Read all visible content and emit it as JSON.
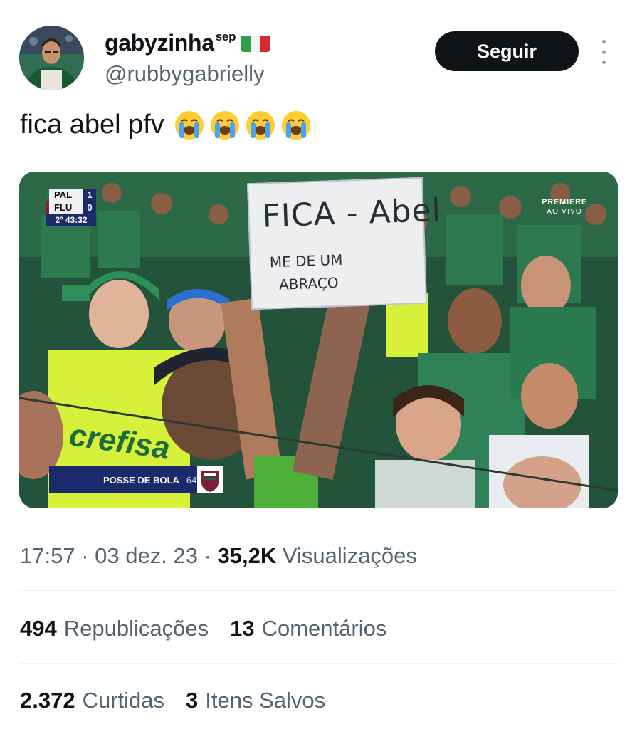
{
  "user": {
    "display_name": "gabyzinha",
    "name_suffix": "sep",
    "handle": "@rubbygabrielly"
  },
  "follow_label": "Seguir",
  "tweet": {
    "text": "fica abel pfv",
    "emoji_name": "loudly-crying-face",
    "emoji_count": 4
  },
  "media": {
    "scoreboard": {
      "home": "PAL",
      "home_goals": "1",
      "away": "FLU",
      "away_goals": "0",
      "clock": "2º 43:32"
    },
    "broadcaster": "PREMIERE",
    "broadcaster_sub": "AO VIVO",
    "sign": {
      "line1": "FICA - Abel",
      "line2": "ME DE UM",
      "line3": "ABRAÇO"
    },
    "shirt_text": "crefisa",
    "possession_label": "POSSE DE BOLA",
    "possession_pct": "64%"
  },
  "meta": {
    "time": "17:57",
    "date": "03 dez. 23",
    "views_count": "35,2K",
    "views_label": "Visualizações",
    "separator": "·"
  },
  "stats": {
    "reposts_count": "494",
    "reposts_label": "Republicações",
    "comments_count": "13",
    "comments_label": "Comentários",
    "likes_count": "2.372",
    "likes_label": "Curtidas",
    "saves_count": "3",
    "saves_label": "Itens Salvos"
  },
  "colors": {
    "text_primary": "#0f1419",
    "text_secondary": "#536471",
    "button_bg": "#0f1419",
    "palmeiras_green": "#1e5a39",
    "shirt_yellow": "#d7f03a",
    "broadcast_blue": "#1b2a6b"
  }
}
